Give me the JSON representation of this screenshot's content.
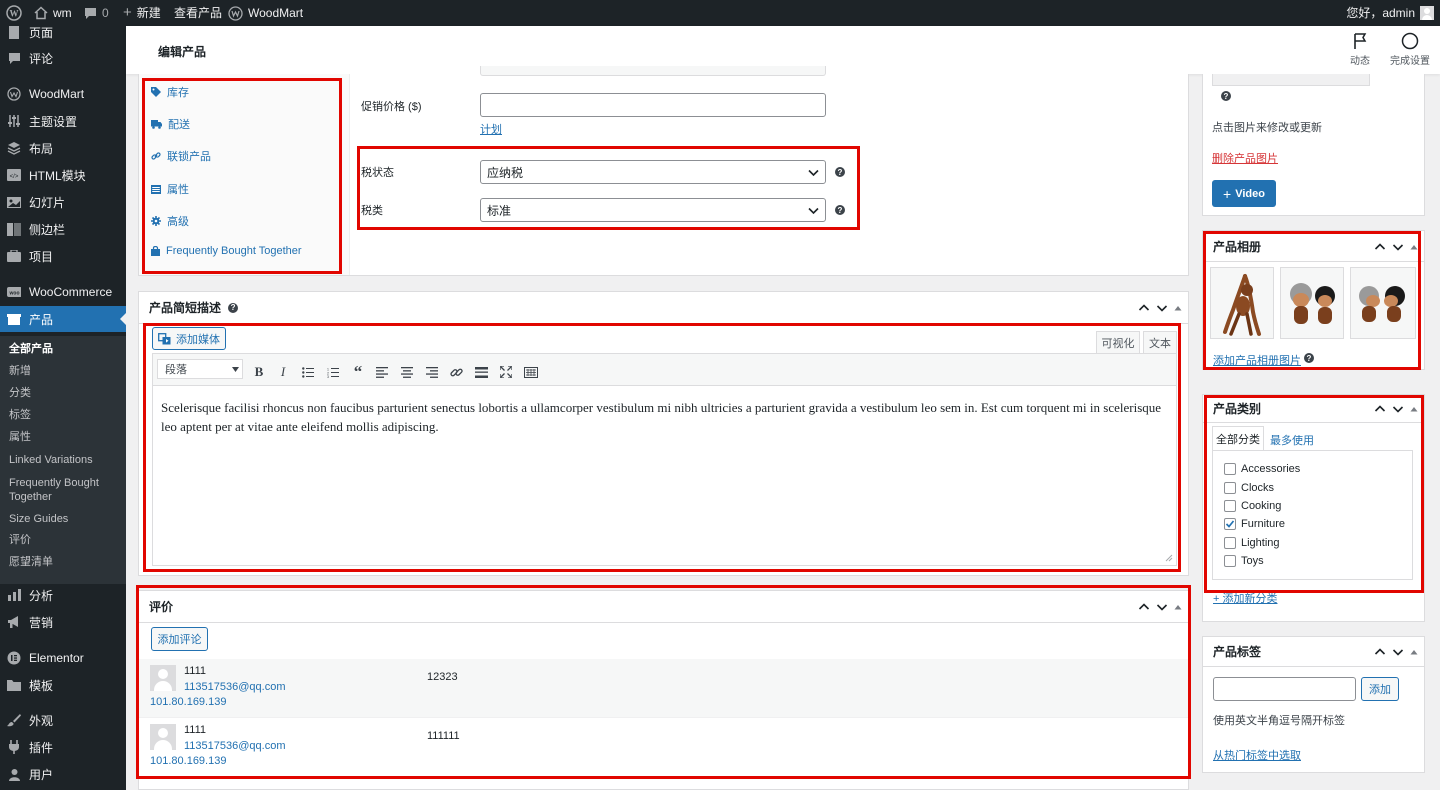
{
  "adminbar": {
    "site_name": "wm",
    "comments_count": "0",
    "new_label": "新建",
    "view_product_label": "查看产品",
    "plugin_label": "WoodMart",
    "greeting": "您好，admin"
  },
  "sidebar": {
    "items": [
      {
        "label": "页面",
        "icon": "page-icon"
      },
      {
        "label": "评论",
        "icon": "comment-icon"
      },
      {
        "label": "WoodMart",
        "icon": "woodmart-icon"
      },
      {
        "label": "主题设置",
        "icon": "sliders-icon"
      },
      {
        "label": "布局",
        "icon": "layers-icon"
      },
      {
        "label": "HTML模块",
        "icon": "html-icon"
      },
      {
        "label": "幻灯片",
        "icon": "slides-icon"
      },
      {
        "label": "侧边栏",
        "icon": "sidebar-icon"
      },
      {
        "label": "项目",
        "icon": "portfolio-icon"
      },
      {
        "label": "WooCommerce",
        "icon": "woo-icon"
      },
      {
        "label": "产品",
        "icon": "product-icon"
      },
      {
        "label": "分析",
        "icon": "chart-icon"
      },
      {
        "label": "营销",
        "icon": "megaphone-icon"
      },
      {
        "label": "Elementor",
        "icon": "elementor-icon"
      },
      {
        "label": "模板",
        "icon": "folder-icon"
      },
      {
        "label": "外观",
        "icon": "brush-icon"
      },
      {
        "label": "插件",
        "icon": "plugin-icon"
      },
      {
        "label": "用户",
        "icon": "user-icon"
      }
    ],
    "submenu": [
      "全部产品",
      "新增",
      "分类",
      "标签",
      "属性",
      "Linked Variations",
      "Frequently Bought Together",
      "Size Guides",
      "评价",
      "愿望清单"
    ]
  },
  "header": {
    "title": "编辑产品",
    "activity_label": "动态",
    "finish_setup_label": "完成设置"
  },
  "product_data": {
    "tabs": [
      "库存",
      "配送",
      "联锁产品",
      "属性",
      "高级",
      "Frequently Bought Together"
    ],
    "sale_price_label": "促销价格 ($)",
    "sale_price_value": "",
    "schedule_link": "计划",
    "tax_status_label": "税状态",
    "tax_status_value": "应纳税",
    "tax_class_label": "税类",
    "tax_class_value": "标准"
  },
  "short_description": {
    "title": "产品简短描述",
    "add_media_label": "添加媒体",
    "tab_visual": "可视化",
    "tab_text": "文本",
    "format_select": "段落",
    "content": "Scelerisque facilisi rhoncus non faucibus parturient senectus lobortis a ullamcorper vestibulum mi nibh ultricies a parturient gravida a vestibulum leo sem in. Est cum torquent mi in scelerisque leo aptent per at vitae ante eleifend mollis adipiscing."
  },
  "reviews": {
    "title": "评价",
    "add_review_label": "添加评论",
    "items": [
      {
        "author": "1111",
        "email": "113517536@qq.com",
        "ip": "101.80.169.139",
        "content": "12323"
      },
      {
        "author": "1111",
        "email": "113517536@qq.com",
        "ip": "101.80.169.139",
        "content": "111111"
      }
    ]
  },
  "product_image": {
    "hint": "点击图片来修改或更新",
    "remove_link": "删除产品图片",
    "video_button": "Video"
  },
  "gallery": {
    "title": "产品相册",
    "add_link": "添加产品相册图片"
  },
  "categories": {
    "title": "产品类别",
    "tab_all": "全部分类",
    "tab_popular": "最多使用",
    "items": [
      {
        "name": "Accessories",
        "checked": false
      },
      {
        "name": "Clocks",
        "checked": false
      },
      {
        "name": "Cooking",
        "checked": false
      },
      {
        "name": "Furniture",
        "checked": true
      },
      {
        "name": "Lighting",
        "checked": false
      },
      {
        "name": "Toys",
        "checked": false
      }
    ],
    "add_new_link": "+ 添加新分类"
  },
  "tags": {
    "title": "产品标签",
    "input_value": "",
    "add_button": "添加",
    "hint": "使用英文半角逗号隔开标签",
    "choose_link": "从热门标签中选取"
  },
  "colors": {
    "admin_bg": "#1d2327",
    "accent": "#2271b1",
    "highlight_box": "#e10600"
  }
}
